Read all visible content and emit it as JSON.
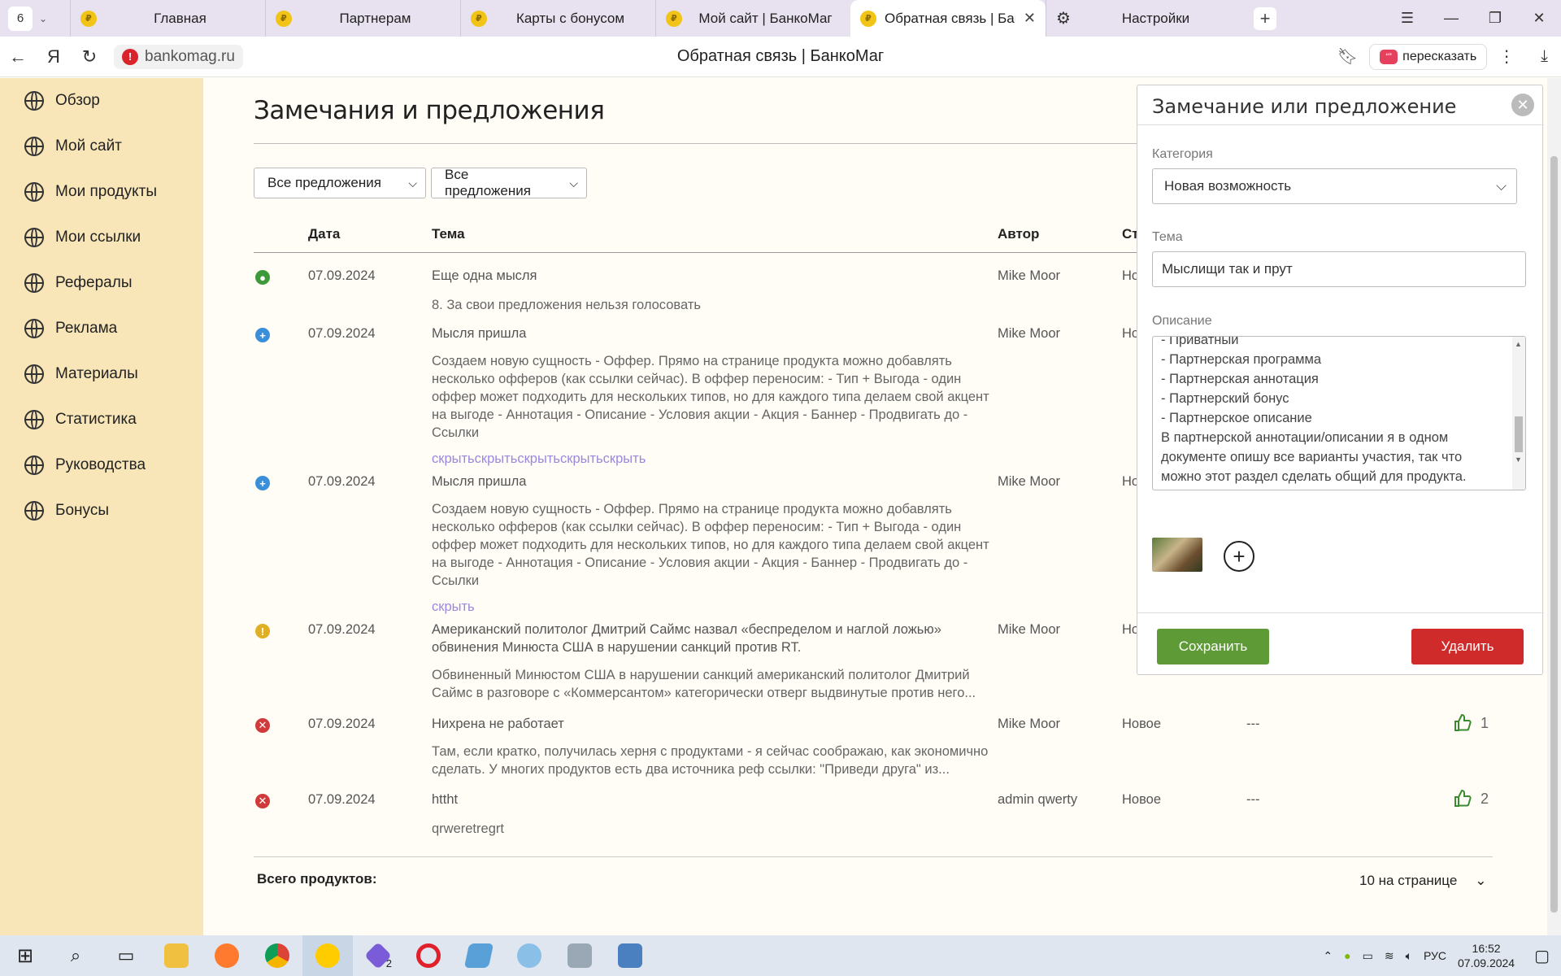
{
  "browser": {
    "tab_count": "6",
    "tabs": [
      {
        "label": "Главная"
      },
      {
        "label": "Партнерам"
      },
      {
        "label": "Карты с бонусом"
      },
      {
        "label": "Мой сайт | БанкоМаг"
      },
      {
        "label": "Обратная связь | Банко"
      },
      {
        "label": "Настройки"
      }
    ],
    "url": "bankomag.ru",
    "page_title": "Обратная связь | БанкоМаг",
    "retell_label": "пересказать"
  },
  "sidebar": {
    "items": [
      {
        "label": "Обзор"
      },
      {
        "label": "Мой сайт"
      },
      {
        "label": "Мои продукты"
      },
      {
        "label": "Мои ссылки"
      },
      {
        "label": "Рефералы"
      },
      {
        "label": "Реклама"
      },
      {
        "label": "Материалы"
      },
      {
        "label": "Статистика"
      },
      {
        "label": "Руководства"
      },
      {
        "label": "Бонусы"
      }
    ]
  },
  "main": {
    "heading": "Замечания и предложения",
    "filter1": "Все предложения",
    "filter2": "Все предложения",
    "columns": {
      "date": "Дата",
      "theme": "Тема",
      "author": "Автор",
      "status": "Ст"
    },
    "rows": [
      {
        "date": "07.09.2024",
        "theme": "Еще одна мысля",
        "desc": "8. За свои предложения нельзя голосовать",
        "author": "Mike Moor",
        "status": "Но"
      },
      {
        "date": "07.09.2024",
        "theme": "Мысля пришла",
        "desc": "Создаем новую сущность - Оффер. Прямо на странице продукта можно добавлять несколько офферов (как ссылки сейчас). В оффер переносим: - Тип + Выгода - один оффер может подходить для нескольких типов, но для каждого типа делаем свой акцент на выгоде - Аннотация - Описание - Условия акции - Акция - Баннер - Продвигать до - Ссылки",
        "author": "Mike Moor",
        "status": "Но",
        "hide": "скрытьскрытьскрытьскрытьскрыть"
      },
      {
        "date": "07.09.2024",
        "theme": "Мысля пришла",
        "desc": "Создаем новую сущность - Оффер. Прямо на странице продукта можно добавлять несколько офферов (как ссылки сейчас). В оффер переносим: - Тип + Выгода - один оффер может подходить для нескольких типов, но для каждого типа делаем свой акцент на выгоде - Аннотация - Описание - Условия акции - Акция - Баннер - Продвигать до - Ссылки",
        "author": "Mike Moor",
        "status": "Но",
        "hide": "скрыть"
      },
      {
        "date": "07.09.2024",
        "theme": "Американский политолог Дмитрий Саймс назвал «беспределом и наглой ложью» обвинения Минюста США в нарушении санкций против RT.",
        "desc": "Обвиненный Минюстом США в нарушении санкций американский политолог Дмитрий Саймс в разговоре с «Коммерсантом» категорически отверг выдвинутые против него...",
        "author": "Mike Moor",
        "status": "Но"
      },
      {
        "date": "07.09.2024",
        "theme": "Нихрена не работает",
        "desc": "Там, если кратко, получилась херня с продуктами - я сейчас соображаю, как экономично сделать. У многих продуктов есть два источника реф ссылки: \"Приведи друга\" из...",
        "author": "Mike Moor",
        "status": "Новое",
        "dash": "---",
        "likes": "1"
      },
      {
        "date": "07.09.2024",
        "theme": "httht",
        "desc": "qrweretregrt",
        "author": "admin qwerty",
        "status": "Новое",
        "dash": "---",
        "likes": "2"
      }
    ],
    "total_label": "Всего продуктов:",
    "per_page": "10 на странице"
  },
  "modal": {
    "title": "Замечание или предложение",
    "category_label": "Категория",
    "category_value": "Новая возможность",
    "theme_label": "Тема",
    "theme_value": "Мыслищи так и прут",
    "description_label": "Описание",
    "description_value": "- Приватный\n- Партнерская программа\n- Партнерская аннотация\n- Партнерский бонус\n- Партнерское описание\nВ партнерской аннотации/описании я в одном документе опишу все варианты участия, так что можно этот раздел сделать общий для продукта.",
    "save_label": "Сохранить",
    "delete_label": "Удалить"
  },
  "taskbar": {
    "lang": "РУС",
    "time": "16:52",
    "date": "07.09.2024",
    "badge": "2"
  },
  "colors": {
    "sidebar_bg": "#f9e6b8",
    "save_green": "#5e9b36",
    "delete_red": "#cf2b2b",
    "link_purple": "#9a88e0",
    "status_green": "#3d9a3a",
    "status_blue": "#3b8fd8",
    "status_yellow": "#e0b024",
    "status_red": "#d03a3a"
  }
}
